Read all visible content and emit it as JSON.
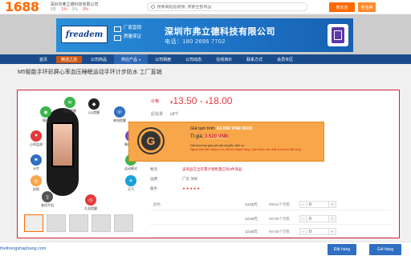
{
  "topbar": {
    "logo": "1688",
    "company": "深圳市弗立德科技有限公司",
    "stats": [
      "3年",
      "1%",
      "3%",
      "3%"
    ],
    "search_placeholder": "搜索或粘贴链接, 搜索全部商品",
    "search_btn": "搜本店",
    "right_btn": "搜全网"
  },
  "banner": {
    "brand": "freadem",
    "badge1": "厂家直销",
    "badge2": "质量保证",
    "title": "深圳市弗立德科技有限公司",
    "phone": "电话：180 2696 7702"
  },
  "nav": {
    "items": [
      "首页",
      "精选之选",
      "公司商品",
      "供应产品",
      "公司相册",
      "公司动态",
      "在线询价",
      "联系方式",
      "会员专区"
    ]
  },
  "product": {
    "title": "M5智能手环彩屏心率血压睡眠运动手环计步防水 工厂直销",
    "price_label": "价格",
    "price_low": "13.50",
    "price_high": "18.00",
    "currency": "¥",
    "moq_label": "起批量",
    "moq_value": "≥2个"
  },
  "gallery": {
    "features": [
      "消息提醒",
      "微信",
      "QQ提醒",
      "来电提醒",
      "心率监测",
      "睡眠监测",
      "计步",
      "运动模式",
      "拍照",
      "天气",
      "查找手机",
      "久坐提醒"
    ],
    "thumb_count": 5
  },
  "conversion": {
    "logo_letter": "G",
    "line1_prefix": "Giá tạm tính: ",
    "line1_value": "63.550 VNĐ (¥18)",
    "line2_prefix": "Tỉ giá: ",
    "line2_value": "3.520 VNĐ",
    "line3": "Giá chưa bao gồm phí vận chuyển, dịch vụ",
    "line4": "Người bán hiện đang có ưu đãi cho khách hàng. Quý khách cần nhắc trước khi đặt hàng."
  },
  "info_rows": [
    {
      "label": "物流",
      "value": "该商品在全年累计销售量已有0件商品"
    },
    {
      "label": "运费",
      "value": "广东 深圳"
    },
    {
      "label": "服务",
      "value": "★★★★★"
    }
  ],
  "variants": [
    {
      "label": "颜色",
      "price": "13.50元",
      "stock": "99824个可售",
      "qty": "0"
    },
    {
      "label": "",
      "price": "13.50元",
      "stock": "99799个可售",
      "qty": "0"
    },
    {
      "label": "",
      "price": "13.50元",
      "stock": "99759个可售",
      "qty": "0"
    }
  ],
  "footer": {
    "site": "thethongshaphang.com",
    "btn_cart": "Đặt hàng",
    "btn_buy": "Giỏ hàng"
  },
  "colors": {
    "brand_orange": "#ff6a00",
    "nav_blue": "#1a4c8c",
    "price_red": "#e4393c",
    "conv_orange": "#f7a64a"
  }
}
